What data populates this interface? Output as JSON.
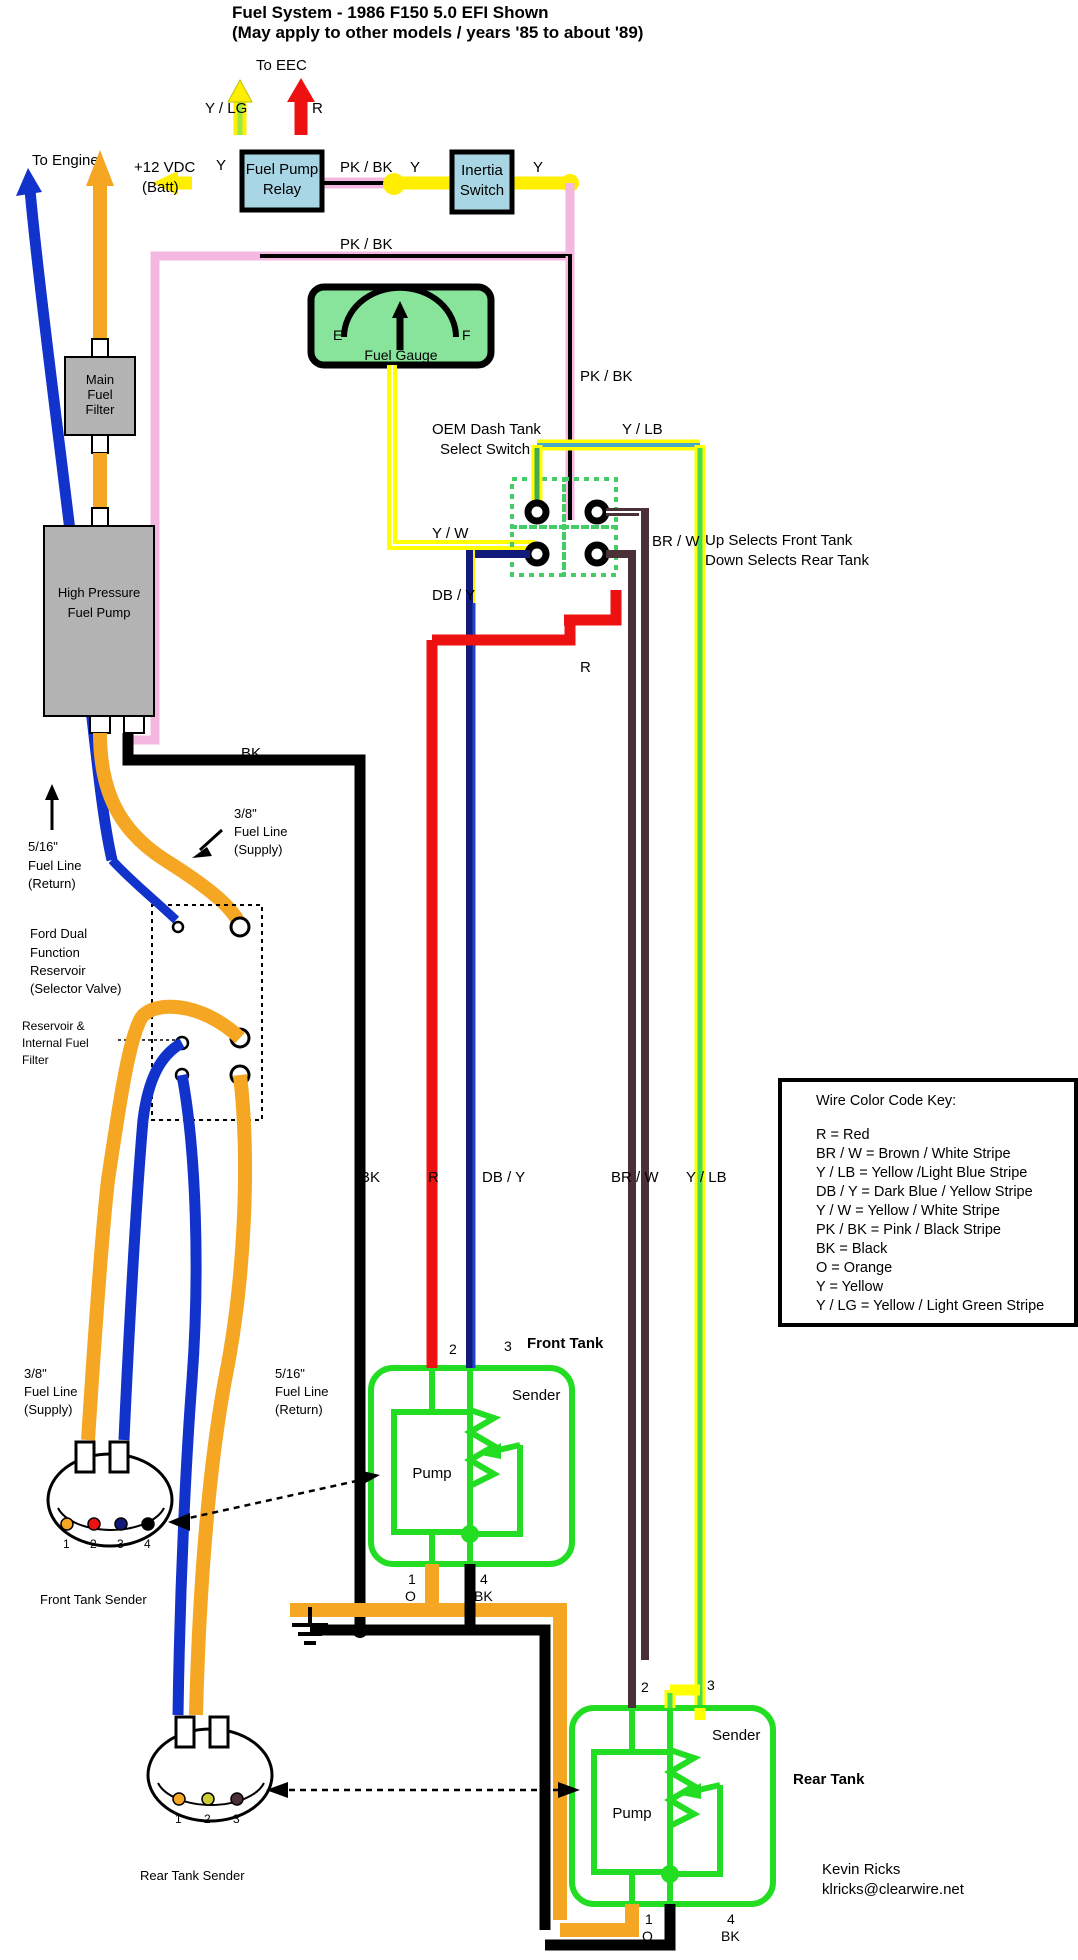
{
  "title": {
    "line1": "Fuel System - 1986 F150 5.0 EFI Shown",
    "line2": "(May apply to other models / years '85 to about '89)"
  },
  "boxes": {
    "fuel_pump_relay": "Fuel Pump\nRelay",
    "fuel_pump_relay_l1": "Fuel Pump",
    "fuel_pump_relay_l2": "Relay",
    "inertia_switch_l1": "Inertia",
    "inertia_switch_l2": "Switch",
    "fuel_gauge": "Fuel Gauge",
    "gauge_empty": "E",
    "gauge_full": "F",
    "main_fuel_filter_l1": "Main",
    "main_fuel_filter_l2": "Fuel",
    "main_fuel_filter_l3": "Filter",
    "high_pressure_pump_l1": "High Pressure",
    "high_pressure_pump_l2": "Fuel Pump"
  },
  "labels": {
    "to_eec": "To EEC",
    "to_engine": "To Engine",
    "plus12": "+12 VDC",
    "batt": "(Batt)",
    "y_lg": "Y / LG",
    "r": "R",
    "y1": "Y",
    "pk_bk_1": "PK / BK",
    "y2": "Y",
    "y3": "Y",
    "pk_bk_2": "PK / BK",
    "pk_bk_3": "PK / BK",
    "oem_switch_l1": "OEM  Dash Tank",
    "oem_switch_l2": "Select Switch",
    "y_lb_top": "Y / LB",
    "y_w": "Y / W",
    "br_w": "BR / W",
    "db_y": "DB / Y",
    "r_switch": "R",
    "up_selects": "Up Selects Front Tank",
    "down_selects": "Down Selects Rear Tank",
    "bk_top": "BK",
    "supply_38_l1": "3/8\"",
    "supply_38_l2": "Fuel Line",
    "supply_38_l3": "(Supply)",
    "return_516_l1": "5/16\"",
    "return_516_l2": "Fuel Line",
    "return_516_l3": "(Return)",
    "reservoir_l1": "Ford Dual",
    "reservoir_l2": "Function",
    "reservoir_l3": "Reservoir",
    "reservoir_l4": "(Selector Valve)",
    "res_filter_l1": "Reservoir &",
    "res_filter_l2": "Internal Fuel",
    "res_filter_l3": "Filter",
    "bk_mid": "BK",
    "r_mid": "R",
    "db_y_mid": "DB / Y",
    "br_w_mid": "BR / W",
    "y_lb_mid": "Y / LB",
    "supply_38_b_l1": "3/8\"",
    "supply_38_b_l2": "Fuel Line",
    "supply_38_b_l3": "(Supply)",
    "return_516_b_l1": "5/16\"",
    "return_516_b_l2": "Fuel Line",
    "return_516_b_l3": "(Return)",
    "front_tank": "Front Tank",
    "rear_tank": "Rear Tank",
    "front_tank_sender": "Front Tank Sender",
    "rear_tank_sender": "Rear Tank Sender",
    "pump": "Pump",
    "sender": "Sender",
    "pin2": "2",
    "pin3": "3",
    "pin1": "1",
    "pin4": "4",
    "pin_o": "O",
    "pin_bk": "BK",
    "author_name": "Kevin Ricks",
    "author_email": "klricks@clearwire.net"
  },
  "sender_pins": {
    "front": [
      "1",
      "2",
      "3",
      "4"
    ],
    "rear": [
      "1",
      "2",
      "3"
    ]
  },
  "key": {
    "title": "Wire Color Code Key:",
    "entries": [
      "R = Red",
      "BR / W = Brown / White Stripe",
      "Y / LB = Yellow /Light Blue Stripe",
      "DB / Y = Dark Blue / Yellow Stripe",
      "Y / W = Yellow / White Stripe",
      "PK / BK = Pink / Black Stripe",
      "BK = Black",
      "O = Orange",
      "Y = Yellow",
      "Y / LG = Yellow / Light Green Stripe"
    ]
  },
  "colors": {
    "red": "#ee1111",
    "yellow": "#ffee00",
    "yellow_bright": "#ffff00",
    "pink": "#f4b8e0",
    "black": "#000000",
    "box_blue": "#a9d6e5",
    "gauge_green": "#88e49a",
    "tank_green": "#22dd22",
    "switch_green": "#44cc66",
    "orange": "#f5a623",
    "blue": "#1133cc",
    "darkblue": "#111a7a",
    "brown": "#4b3038",
    "grey": "#b3b3b3",
    "lightblue_stripe": "#4aa8c8",
    "lightgreen_stripe": "#9ae84a"
  }
}
